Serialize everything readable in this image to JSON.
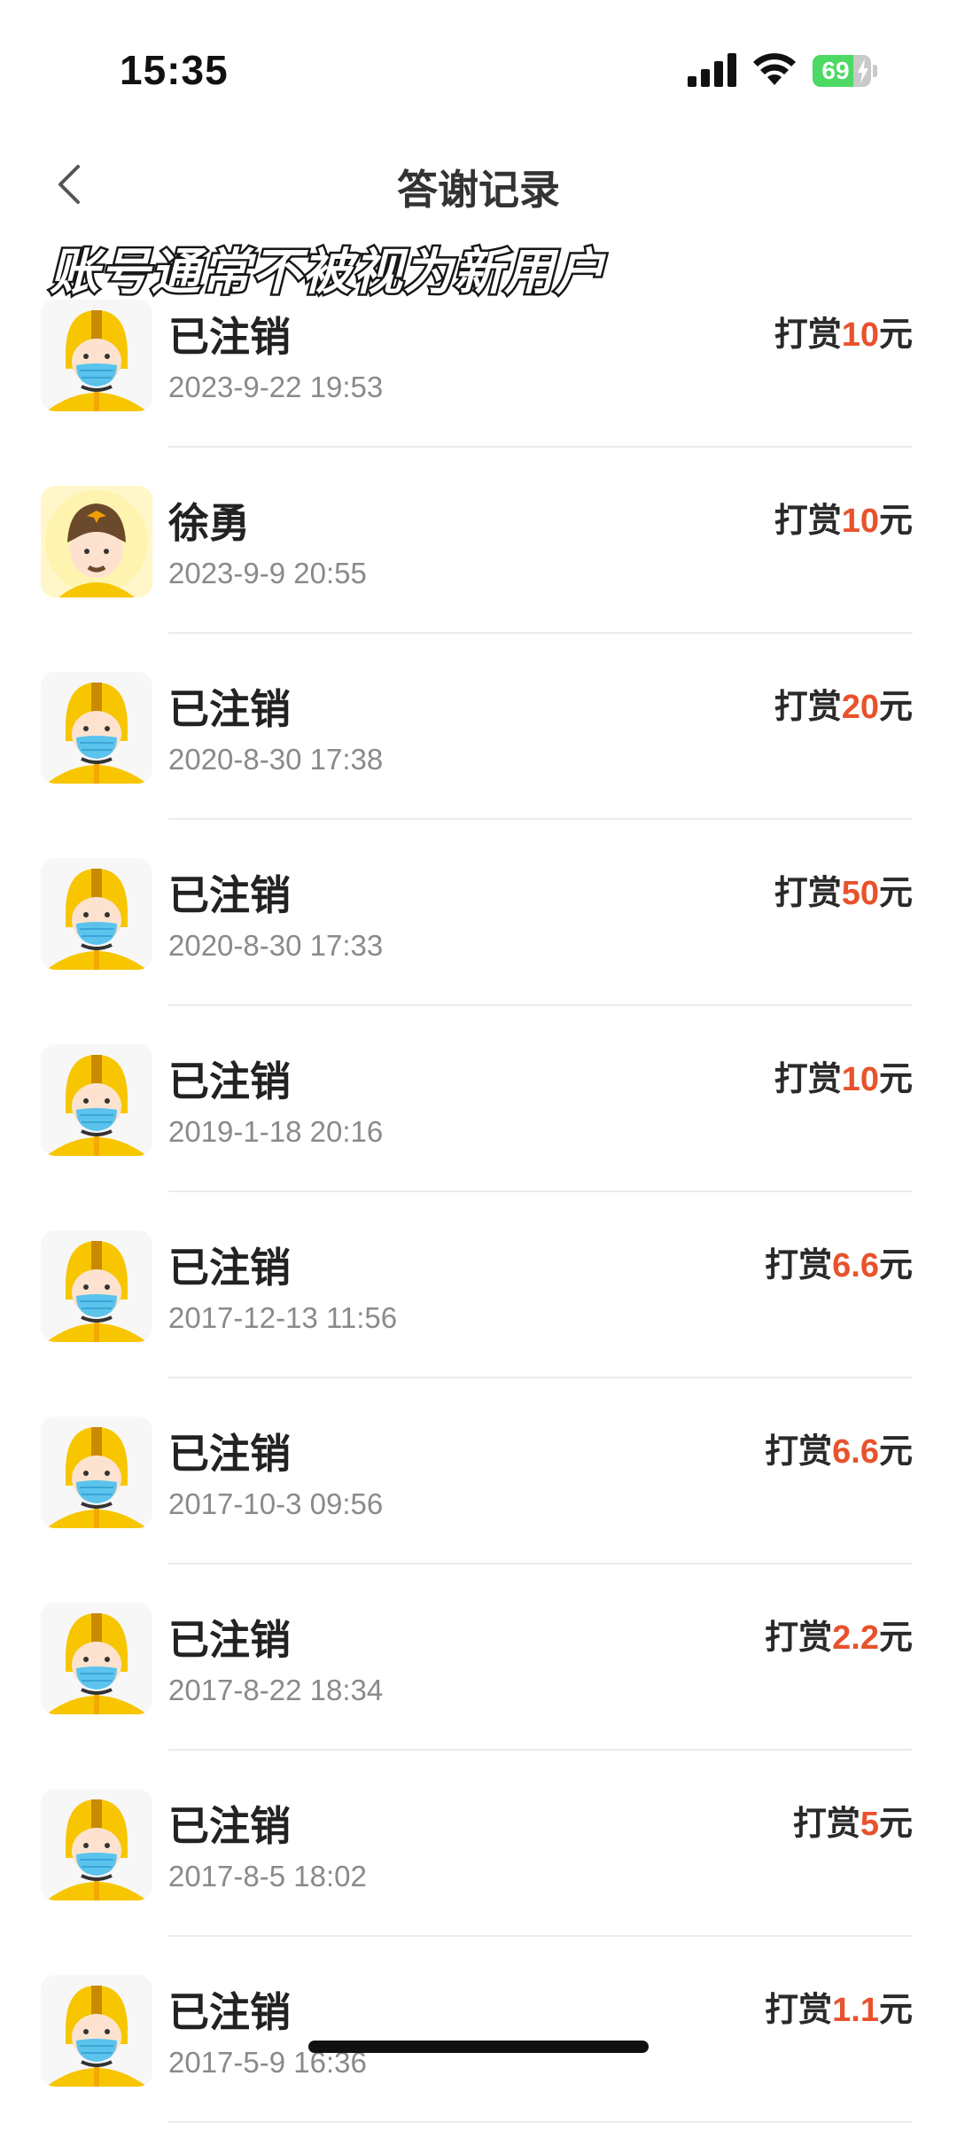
{
  "status_bar": {
    "time": "15:35",
    "battery_level": "69",
    "battery_percent": 69
  },
  "nav": {
    "back_icon": "chevron-left-icon",
    "title": "答谢记录"
  },
  "overlay_caption": "账号通常不被视为新用户",
  "tip_prefix": "打赏",
  "tip_suffix": "元",
  "records": [
    {
      "name": "已注销",
      "time": "2023-9-22 19:53",
      "amount": "10",
      "avatar": "masked-rider"
    },
    {
      "name": "徐勇",
      "time": "2023-9-9 20:55",
      "amount": "10",
      "avatar": "helmet-rider"
    },
    {
      "name": "已注销",
      "time": "2020-8-30 17:38",
      "amount": "20",
      "avatar": "masked-rider"
    },
    {
      "name": "已注销",
      "time": "2020-8-30 17:33",
      "amount": "50",
      "avatar": "masked-rider"
    },
    {
      "name": "已注销",
      "time": "2019-1-18 20:16",
      "amount": "10",
      "avatar": "masked-rider"
    },
    {
      "name": "已注销",
      "time": "2017-12-13 11:56",
      "amount": "6.6",
      "avatar": "masked-rider"
    },
    {
      "name": "已注销",
      "time": "2017-10-3 09:56",
      "amount": "6.6",
      "avatar": "masked-rider"
    },
    {
      "name": "已注销",
      "time": "2017-8-22 18:34",
      "amount": "2.2",
      "avatar": "masked-rider"
    },
    {
      "name": "已注销",
      "time": "2017-8-5 18:02",
      "amount": "5",
      "avatar": "masked-rider"
    },
    {
      "name": "已注销",
      "time": "2017-5-9 16:36",
      "amount": "1.1",
      "avatar": "masked-rider"
    }
  ],
  "colors": {
    "accent": "#e8522c",
    "helmet": "#f7c600",
    "mask": "#5bc3ec"
  }
}
